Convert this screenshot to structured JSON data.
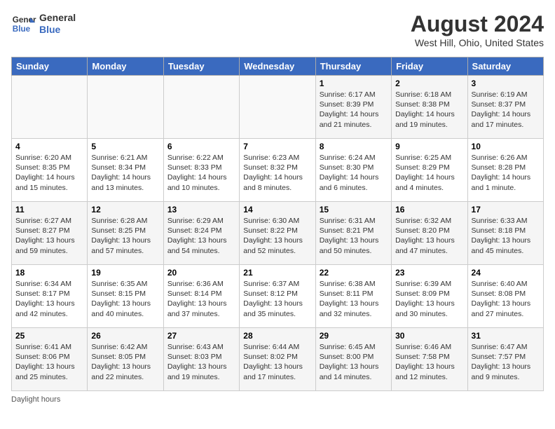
{
  "header": {
    "logo_line1": "General",
    "logo_line2": "Blue",
    "month": "August 2024",
    "location": "West Hill, Ohio, United States"
  },
  "weekdays": [
    "Sunday",
    "Monday",
    "Tuesday",
    "Wednesday",
    "Thursday",
    "Friday",
    "Saturday"
  ],
  "weeks": [
    [
      {
        "day": "",
        "info": ""
      },
      {
        "day": "",
        "info": ""
      },
      {
        "day": "",
        "info": ""
      },
      {
        "day": "",
        "info": ""
      },
      {
        "day": "1",
        "info": "Sunrise: 6:17 AM\nSunset: 8:39 PM\nDaylight: 14 hours\nand 21 minutes."
      },
      {
        "day": "2",
        "info": "Sunrise: 6:18 AM\nSunset: 8:38 PM\nDaylight: 14 hours\nand 19 minutes."
      },
      {
        "day": "3",
        "info": "Sunrise: 6:19 AM\nSunset: 8:37 PM\nDaylight: 14 hours\nand 17 minutes."
      }
    ],
    [
      {
        "day": "4",
        "info": "Sunrise: 6:20 AM\nSunset: 8:35 PM\nDaylight: 14 hours\nand 15 minutes."
      },
      {
        "day": "5",
        "info": "Sunrise: 6:21 AM\nSunset: 8:34 PM\nDaylight: 14 hours\nand 13 minutes."
      },
      {
        "day": "6",
        "info": "Sunrise: 6:22 AM\nSunset: 8:33 PM\nDaylight: 14 hours\nand 10 minutes."
      },
      {
        "day": "7",
        "info": "Sunrise: 6:23 AM\nSunset: 8:32 PM\nDaylight: 14 hours\nand 8 minutes."
      },
      {
        "day": "8",
        "info": "Sunrise: 6:24 AM\nSunset: 8:30 PM\nDaylight: 14 hours\nand 6 minutes."
      },
      {
        "day": "9",
        "info": "Sunrise: 6:25 AM\nSunset: 8:29 PM\nDaylight: 14 hours\nand 4 minutes."
      },
      {
        "day": "10",
        "info": "Sunrise: 6:26 AM\nSunset: 8:28 PM\nDaylight: 14 hours\nand 1 minute."
      }
    ],
    [
      {
        "day": "11",
        "info": "Sunrise: 6:27 AM\nSunset: 8:27 PM\nDaylight: 13 hours\nand 59 minutes."
      },
      {
        "day": "12",
        "info": "Sunrise: 6:28 AM\nSunset: 8:25 PM\nDaylight: 13 hours\nand 57 minutes."
      },
      {
        "day": "13",
        "info": "Sunrise: 6:29 AM\nSunset: 8:24 PM\nDaylight: 13 hours\nand 54 minutes."
      },
      {
        "day": "14",
        "info": "Sunrise: 6:30 AM\nSunset: 8:22 PM\nDaylight: 13 hours\nand 52 minutes."
      },
      {
        "day": "15",
        "info": "Sunrise: 6:31 AM\nSunset: 8:21 PM\nDaylight: 13 hours\nand 50 minutes."
      },
      {
        "day": "16",
        "info": "Sunrise: 6:32 AM\nSunset: 8:20 PM\nDaylight: 13 hours\nand 47 minutes."
      },
      {
        "day": "17",
        "info": "Sunrise: 6:33 AM\nSunset: 8:18 PM\nDaylight: 13 hours\nand 45 minutes."
      }
    ],
    [
      {
        "day": "18",
        "info": "Sunrise: 6:34 AM\nSunset: 8:17 PM\nDaylight: 13 hours\nand 42 minutes."
      },
      {
        "day": "19",
        "info": "Sunrise: 6:35 AM\nSunset: 8:15 PM\nDaylight: 13 hours\nand 40 minutes."
      },
      {
        "day": "20",
        "info": "Sunrise: 6:36 AM\nSunset: 8:14 PM\nDaylight: 13 hours\nand 37 minutes."
      },
      {
        "day": "21",
        "info": "Sunrise: 6:37 AM\nSunset: 8:12 PM\nDaylight: 13 hours\nand 35 minutes."
      },
      {
        "day": "22",
        "info": "Sunrise: 6:38 AM\nSunset: 8:11 PM\nDaylight: 13 hours\nand 32 minutes."
      },
      {
        "day": "23",
        "info": "Sunrise: 6:39 AM\nSunset: 8:09 PM\nDaylight: 13 hours\nand 30 minutes."
      },
      {
        "day": "24",
        "info": "Sunrise: 6:40 AM\nSunset: 8:08 PM\nDaylight: 13 hours\nand 27 minutes."
      }
    ],
    [
      {
        "day": "25",
        "info": "Sunrise: 6:41 AM\nSunset: 8:06 PM\nDaylight: 13 hours\nand 25 minutes."
      },
      {
        "day": "26",
        "info": "Sunrise: 6:42 AM\nSunset: 8:05 PM\nDaylight: 13 hours\nand 22 minutes."
      },
      {
        "day": "27",
        "info": "Sunrise: 6:43 AM\nSunset: 8:03 PM\nDaylight: 13 hours\nand 19 minutes."
      },
      {
        "day": "28",
        "info": "Sunrise: 6:44 AM\nSunset: 8:02 PM\nDaylight: 13 hours\nand 17 minutes."
      },
      {
        "day": "29",
        "info": "Sunrise: 6:45 AM\nSunset: 8:00 PM\nDaylight: 13 hours\nand 14 minutes."
      },
      {
        "day": "30",
        "info": "Sunrise: 6:46 AM\nSunset: 7:58 PM\nDaylight: 13 hours\nand 12 minutes."
      },
      {
        "day": "31",
        "info": "Sunrise: 6:47 AM\nSunset: 7:57 PM\nDaylight: 13 hours\nand 9 minutes."
      }
    ]
  ],
  "footer": "Daylight hours"
}
